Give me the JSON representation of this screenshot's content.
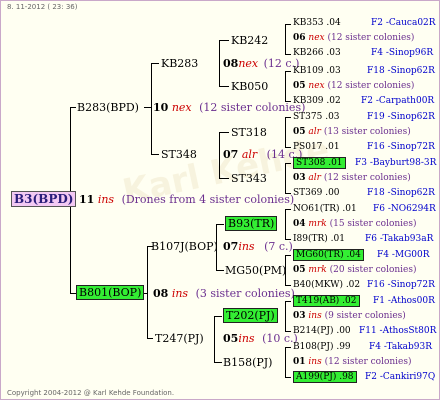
{
  "header": {
    "date": "8. 11-2012 ( 23: 36)"
  },
  "footer": {
    "copyright": "Copyright 2004-2012 @ Karl Kehde Foundation."
  },
  "root": {
    "label": "B3(BPD)",
    "gen": "11",
    "mark": "ins",
    "note": "(Drones from 4 sister colonies)"
  },
  "g10": [
    {
      "label": "B283(BPD)",
      "gen": "10",
      "mark": "nex",
      "note": "(12 sister colonies)"
    },
    {
      "label": "B801(BOP)",
      "gen": "08",
      "mark": "ins",
      "note": "(3 sister colonies)"
    }
  ],
  "g8": [
    {
      "label": "KB283",
      "gen": "08",
      "mark": "nex",
      "note": "(12 c.)"
    },
    {
      "label": "ST348",
      "gen": "07",
      "mark": "alr",
      "note": "(14 c.)"
    },
    {
      "label": "B107J(BOP)",
      "gen": "07",
      "mark": "ins",
      "note": "(7 c.)"
    },
    {
      "label": "T247(PJ)",
      "gen": "05",
      "mark": "ins",
      "note": "(10 c.)"
    }
  ],
  "g7": [
    {
      "label": "KB242"
    },
    {
      "label": "KB050"
    },
    {
      "label": "ST318"
    },
    {
      "label": "ST343"
    },
    {
      "label": "B93(TR)"
    },
    {
      "label": "MG50(PM)"
    },
    {
      "label": "T202(PJ)"
    },
    {
      "label": "B158(PJ)"
    }
  ],
  "leaves": [
    {
      "a": "KB353 .04",
      "b": "F2 -Cauca02R"
    },
    {
      "gen": "06",
      "mark": "nex",
      "note": "(12 sister colonies)"
    },
    {
      "a": "KB266 .03",
      "b": "F4 -Sinop96R"
    },
    {
      "a": "KB109 .03",
      "b": "F18 -Sinop62R"
    },
    {
      "gen": "05",
      "mark": "nex",
      "note": "(12 sister colonies)"
    },
    {
      "a": "KB309 .02",
      "b": "F2 -Carpath00R"
    },
    {
      "a": "ST375 .03",
      "b": "F19 -Sinop62R"
    },
    {
      "gen": "05",
      "mark": "alr",
      "note": "(13 sister colonies)"
    },
    {
      "a": "PS017 .01",
      "b": "F16 -Sinop72R"
    },
    {
      "a": "ST308 .01",
      "b": "F3 -Bayburt98-3R"
    },
    {
      "gen": "03",
      "mark": "alr",
      "note": "(12 sister colonies)"
    },
    {
      "a": "ST369 .00",
      "b": "F18 -Sinop62R"
    },
    {
      "a": "NO61(TR) .01",
      "b": "F6 -NO6294R"
    },
    {
      "gen": "04",
      "mark": "mrk",
      "note": "(15 sister colonies)"
    },
    {
      "a": "I89(TR) .01",
      "b": "F6 -Takab93aR"
    },
    {
      "a": "MG60(TR) .04",
      "b": "F4 -MG00R"
    },
    {
      "gen": "05",
      "mark": "mrk",
      "note": "(20 sister colonies)"
    },
    {
      "a": "B40(MKW) .02",
      "b": "F16 -Sinop72R"
    },
    {
      "a": "T419(AB) .02",
      "b": "F1 -Athos00R"
    },
    {
      "gen": "03",
      "mark": "ins",
      "note": "(9 sister colonies)"
    },
    {
      "a": "B214(PJ) .00",
      "b": "F11 -AthosSt80R"
    },
    {
      "a": "B108(PJ) .99",
      "b": "F4 -Takab93R"
    },
    {
      "gen": "01",
      "mark": "ins",
      "note": "(12 sister colonies)"
    },
    {
      "a": "A199(PJ) .98",
      "b": "F2 -Cankiri97Q"
    }
  ]
}
